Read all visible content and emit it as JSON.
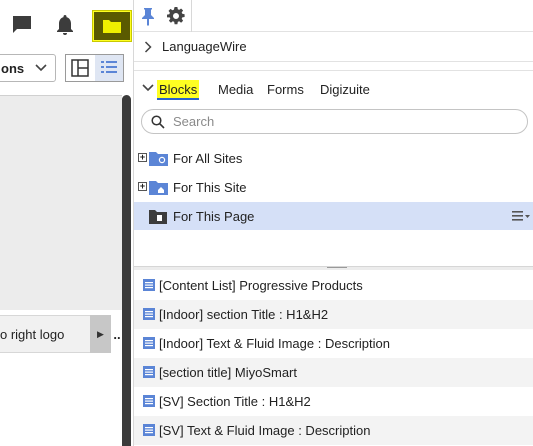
{
  "left_panel": {
    "options_label": "ons",
    "logo_row_label": "o right logo",
    "logo_more": "..",
    "colors": {
      "highlight": "#ffff22",
      "folder_fill": "#5a5a00",
      "scroll_thumb": "#3b3b3b"
    }
  },
  "right_panel": {
    "language_wire_label": "LanguageWire",
    "tabs": [
      {
        "label": "Blocks",
        "active": true
      },
      {
        "label": "Media",
        "active": false
      },
      {
        "label": "Forms",
        "active": false
      },
      {
        "label": "Digizuite",
        "active": false
      }
    ],
    "search": {
      "placeholder": "Search",
      "value": ""
    },
    "tree": [
      {
        "label": "For All Sites",
        "expandable": true,
        "selected": false,
        "icon": "folder-globe-icon"
      },
      {
        "label": "For This Site",
        "expandable": true,
        "selected": false,
        "icon": "folder-home-icon"
      },
      {
        "label": "For This Page",
        "expandable": false,
        "selected": true,
        "icon": "page-folder-icon"
      }
    ],
    "blocks": [
      "[Content List] Progressive Products",
      "[Indoor] section Title : H1&H2",
      "[Indoor] Text & Fluid Image : Description",
      "[section title] MiyoSmart",
      "[SV] Section Title : H1&H2",
      "[SV] Text & Fluid Image : Description"
    ],
    "colors": {
      "accent": "#2a62c9",
      "selected_row": "#d5e0f7",
      "block_icon": "#5b85d6"
    }
  }
}
